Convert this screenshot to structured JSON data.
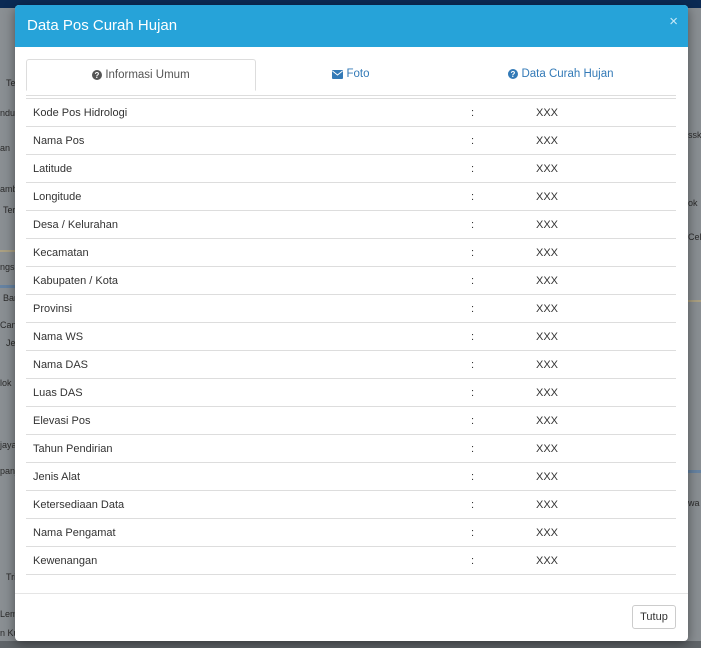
{
  "modal": {
    "title": "Data Pos Curah Hujan",
    "close_glyph": "×"
  },
  "tabs": [
    {
      "label": "Informasi Umum",
      "icon": "question-circle-icon",
      "active": true
    },
    {
      "label": "Foto",
      "icon": "envelope-icon",
      "active": false
    },
    {
      "label": "Data Curah Hujan",
      "icon": "question-circle-icon",
      "active": false
    }
  ],
  "separator": ":",
  "rows": [
    {
      "label": "Kode Pos Hidrologi",
      "value": "XXX"
    },
    {
      "label": "Nama Pos",
      "value": "XXX"
    },
    {
      "label": "Latitude",
      "value": "XXX"
    },
    {
      "label": "Longitude",
      "value": "XXX"
    },
    {
      "label": "Desa / Kelurahan",
      "value": "XXX"
    },
    {
      "label": "Kecamatan",
      "value": "XXX"
    },
    {
      "label": "Kabupaten / Kota",
      "value": "XXX"
    },
    {
      "label": "Provinsi",
      "value": "XXX"
    },
    {
      "label": "Nama WS",
      "value": "XXX"
    },
    {
      "label": "Nama DAS",
      "value": "XXX"
    },
    {
      "label": "Luas DAS",
      "value": "XXX"
    },
    {
      "label": "Elevasi Pos",
      "value": "XXX"
    },
    {
      "label": "Tahun Pendirian",
      "value": "XXX"
    },
    {
      "label": "Jenis Alat",
      "value": "XXX"
    },
    {
      "label": "Ketersediaan Data",
      "value": "XXX"
    },
    {
      "label": "Nama Pengamat",
      "value": "XXX"
    },
    {
      "label": "Kewenangan",
      "value": "XXX"
    }
  ],
  "footer": {
    "close_button": "Tutup"
  },
  "background_map_labels": {
    "left": [
      "Te",
      "ndu",
      "an",
      "amb",
      "Ter",
      "ngs",
      "Ban",
      "Cang",
      "Jer",
      "lok",
      "jaya",
      "panj",
      "Tri",
      "Lem",
      "n Ku"
    ],
    "right": [
      "ssk",
      "ok",
      "Cele",
      "wa"
    ]
  },
  "colors": {
    "header": "#26a3d9",
    "link": "#337ab7",
    "border": "#dddddd"
  }
}
